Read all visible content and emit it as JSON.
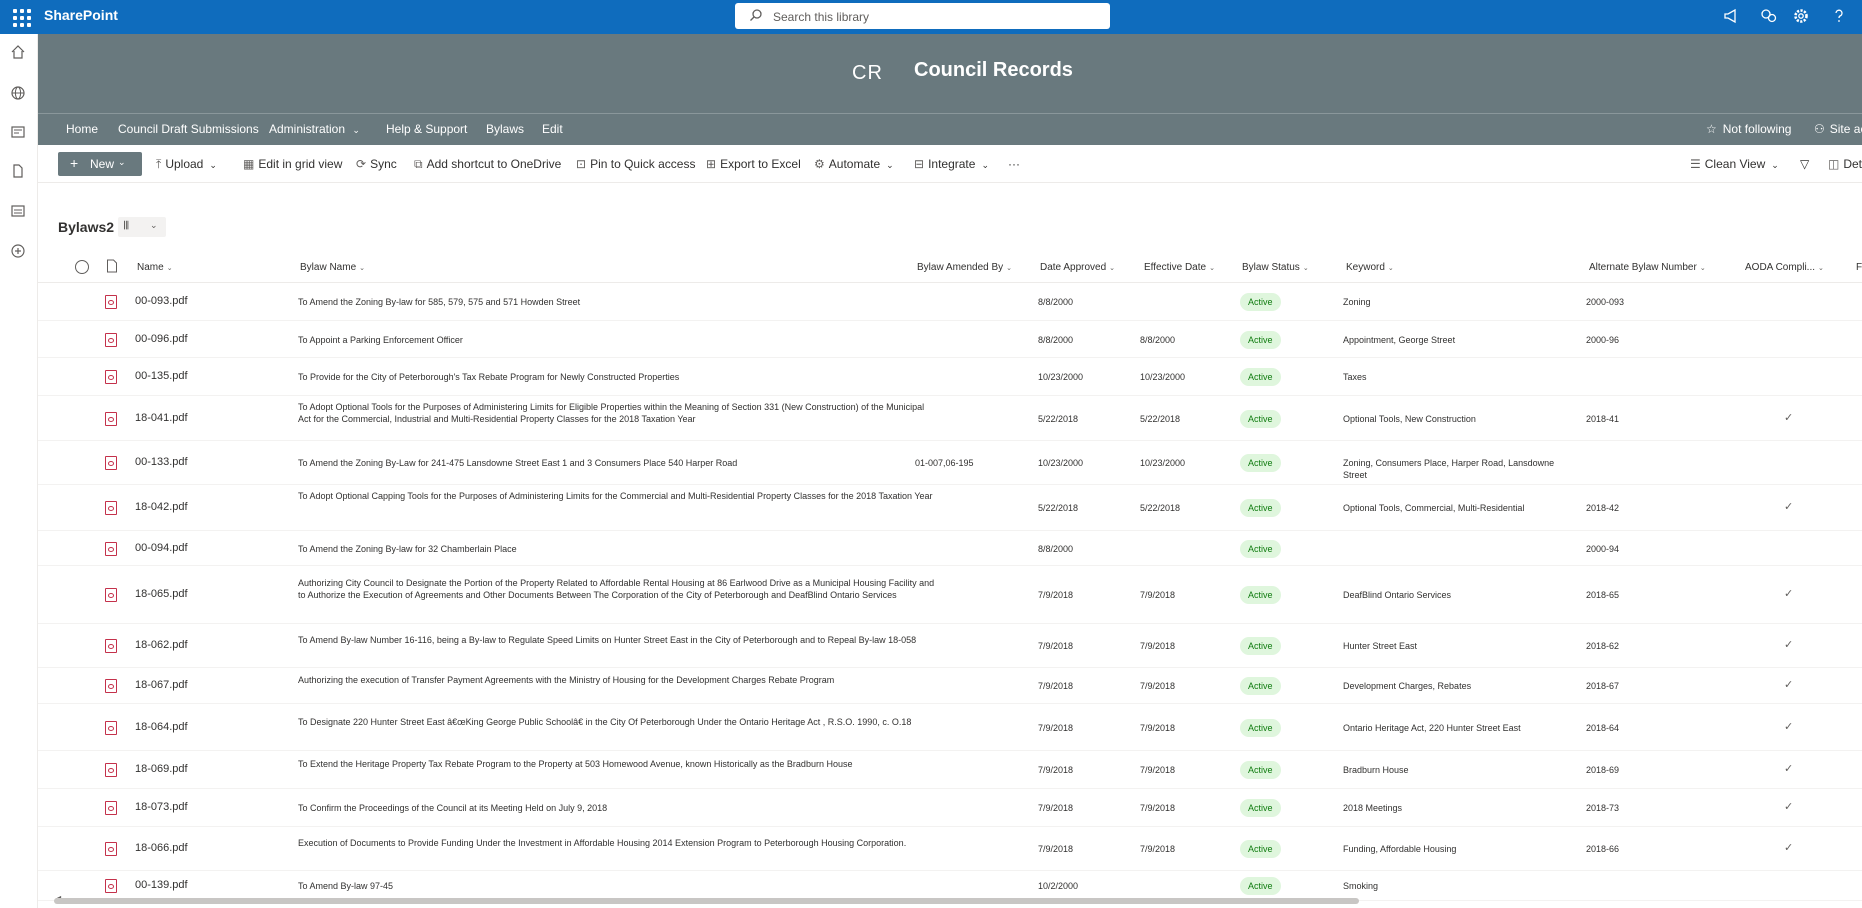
{
  "suite": {
    "brand": "SharePoint"
  },
  "search": {
    "placeholder": "Search this library"
  },
  "site": {
    "logo_text": "CR",
    "title": "Council Records"
  },
  "nav": {
    "items": [
      "Home",
      "Council Draft Submissions",
      "Administration",
      "Help & Support",
      "Bylaws",
      "Edit"
    ],
    "follow_label": "Not following",
    "site_access_label": "Site ac"
  },
  "toolbar": {
    "new_label": "New",
    "upload_label": "Upload",
    "edit_grid_label": "Edit in grid view",
    "sync_label": "Sync",
    "shortcut_label": "Add shortcut to OneDrive",
    "pin_label": "Pin to Quick access",
    "export_label": "Export to Excel",
    "automate_label": "Automate",
    "integrate_label": "Integrate",
    "more_label": "···",
    "view_label": "Clean View",
    "details_label": "Det"
  },
  "library": {
    "title": "Bylaws2"
  },
  "columns": [
    "Name",
    "Bylaw Name",
    "Bylaw Amended By",
    "Date Approved",
    "Effective Date",
    "Bylaw Status",
    "Keyword",
    "Alternate Bylaw Number",
    "AODA Compli...",
    "Fr"
  ],
  "rows": [
    {
      "name": "00-093.pdf",
      "bylaw": "To Amend the Zoning By-law for 585, 579, 575 and 571 Howden Street",
      "amended": "",
      "approved": "8/8/2000",
      "effective": "",
      "status": "Active",
      "keyword": "Zoning",
      "alt": "2000-093",
      "aoda": false
    },
    {
      "name": "00-096.pdf",
      "bylaw": "To Appoint a Parking Enforcement Officer",
      "amended": "",
      "approved": "8/8/2000",
      "effective": "8/8/2000",
      "status": "Active",
      "keyword": "Appointment, George Street",
      "alt": "2000-96",
      "aoda": false
    },
    {
      "name": "00-135.pdf",
      "bylaw": "To Provide for the City of Peterborough's Tax Rebate Program for Newly Constructed Properties",
      "amended": "",
      "approved": "10/23/2000",
      "effective": "10/23/2000",
      "status": "Active",
      "keyword": "Taxes",
      "alt": "",
      "aoda": false
    },
    {
      "name": "18-041.pdf",
      "bylaw": "To Adopt Optional Tools for the Purposes of Administering Limits for Eligible Properties within the Meaning of Section 331 (New Construction) of the Municipal Act for the Commercial, Industrial and Multi-Residential Property Classes for the 2018 Taxation Year",
      "amended": "",
      "approved": "5/22/2018",
      "effective": "5/22/2018",
      "status": "Active",
      "keyword": "Optional Tools, New Construction",
      "alt": "2018-41",
      "aoda": true
    },
    {
      "name": "00-133.pdf",
      "bylaw": "To Amend the Zoning By-Law for 241-475 Lansdowne Street East 1 and 3 Consumers Place 540 Harper Road",
      "amended": "01-007,06-195",
      "approved": "10/23/2000",
      "effective": "10/23/2000",
      "status": "Active",
      "keyword": "Zoning, Consumers Place, Harper Road, Lansdowne Street",
      "alt": "",
      "aoda": false
    },
    {
      "name": "18-042.pdf",
      "bylaw": "To Adopt Optional Capping Tools for the Purposes of Administering Limits for the Commercial and Multi-Residential Property Classes for the 2018 Taxation Year",
      "amended": "",
      "approved": "5/22/2018",
      "effective": "5/22/2018",
      "status": "Active",
      "keyword": "Optional Tools, Commercial, Multi-Residential",
      "alt": "2018-42",
      "aoda": true
    },
    {
      "name": "00-094.pdf",
      "bylaw": "To Amend the Zoning By-law for 32 Chamberlain Place",
      "amended": "",
      "approved": "8/8/2000",
      "effective": "",
      "status": "Active",
      "keyword": "",
      "alt": "2000-94",
      "aoda": false
    },
    {
      "name": "18-065.pdf",
      "bylaw": "Authorizing City Council to Designate the Portion of the Property Related to Affordable Rental Housing at 86 Earlwood Drive as a Municipal Housing Facility and to Authorize the Execution of Agreements and Other Documents Between The Corporation of the City of Peterborough and DeafBlind Ontario Services",
      "amended": "",
      "approved": "7/9/2018",
      "effective": "7/9/2018",
      "status": "Active",
      "keyword": "DeafBlind Ontario Services",
      "alt": "2018-65",
      "aoda": true
    },
    {
      "name": "18-062.pdf",
      "bylaw": "To Amend By-law Number 16-116, being a By-law to Regulate Speed Limits on Hunter Street East in the City of Peterborough and to Repeal By-law 18-058",
      "amended": "",
      "approved": "7/9/2018",
      "effective": "7/9/2018",
      "status": "Active",
      "keyword": "Hunter Street East",
      "alt": "2018-62",
      "aoda": true
    },
    {
      "name": "18-067.pdf",
      "bylaw": "Authorizing the execution of Transfer Payment Agreements with the Ministry of Housing for the Development Charges Rebate Program",
      "amended": "",
      "approved": "7/9/2018",
      "effective": "7/9/2018",
      "status": "Active",
      "keyword": "Development Charges, Rebates",
      "alt": "2018-67",
      "aoda": true
    },
    {
      "name": "18-064.pdf",
      "bylaw": "To Designate 220 Hunter Street East â€œKing George Public Schoolâ€  in the City Of Peterborough Under the Ontario Heritage Act , R.S.O. 1990, c. O.18",
      "amended": "",
      "approved": "7/9/2018",
      "effective": "7/9/2018",
      "status": "Active",
      "keyword": "Ontario Heritage Act, 220 Hunter Street East",
      "alt": "2018-64",
      "aoda": true
    },
    {
      "name": "18-069.pdf",
      "bylaw": "To Extend the Heritage Property Tax Rebate Program to the Property at 503 Homewood Avenue, known Historically as the Bradburn House",
      "amended": "",
      "approved": "7/9/2018",
      "effective": "7/9/2018",
      "status": "Active",
      "keyword": "Bradburn House",
      "alt": "2018-69",
      "aoda": true
    },
    {
      "name": "18-073.pdf",
      "bylaw": "To Confirm the Proceedings of the Council at its Meeting Held on July 9, 2018",
      "amended": "",
      "approved": "7/9/2018",
      "effective": "7/9/2018",
      "status": "Active",
      "keyword": "2018 Meetings",
      "alt": "2018-73",
      "aoda": true
    },
    {
      "name": "18-066.pdf",
      "bylaw": "Execution of Documents to Provide Funding Under the Investment in Affordable Housing 2014 Extension Program to Peterborough Housing Corporation.",
      "amended": "",
      "approved": "7/9/2018",
      "effective": "7/9/2018",
      "status": "Active",
      "keyword": "Funding, Affordable Housing",
      "alt": "2018-66",
      "aoda": true
    },
    {
      "name": "00-139.pdf",
      "bylaw": "To Amend By-law 97-45",
      "amended": "",
      "approved": "10/2/2000",
      "effective": "",
      "status": "Active",
      "keyword": "Smoking",
      "alt": "",
      "aoda": false
    }
  ]
}
